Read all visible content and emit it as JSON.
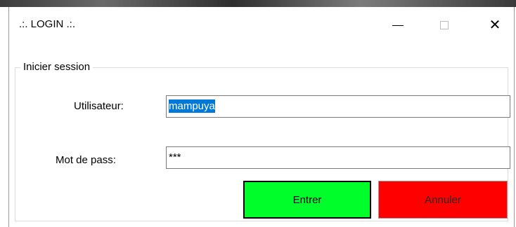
{
  "window": {
    "title": ".:. LOGIN .:.",
    "controls": {
      "minimize": "minimize",
      "maximize": "maximize",
      "close": "close"
    }
  },
  "group": {
    "legend": "Inicier session"
  },
  "form": {
    "user_label": "Utilisateur:",
    "user_value": "mampuya",
    "pass_label": "Mot de pass:",
    "pass_value": "***"
  },
  "buttons": {
    "enter_label": "Entrer",
    "cancel_label": "Annuler"
  },
  "colors": {
    "enter_bg": "#00ff2a",
    "cancel_bg": "#ff0000",
    "selection": "#0078d7"
  },
  "icons": {
    "minimize": "minimize-icon",
    "maximize": "maximize-icon",
    "close": "close-icon"
  }
}
